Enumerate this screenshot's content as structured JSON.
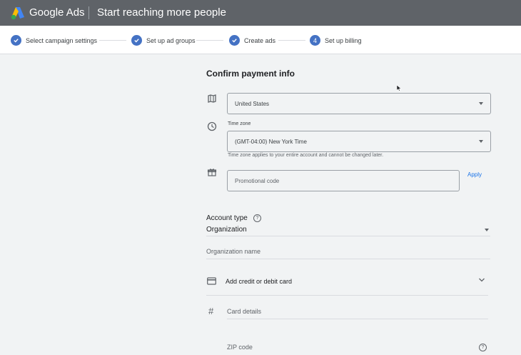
{
  "app": {
    "brand": "Google Ads",
    "heading": "Start reaching more people"
  },
  "stepper": {
    "steps": [
      {
        "label": "Select campaign settings",
        "state": "done"
      },
      {
        "label": "Set up ad groups",
        "state": "done"
      },
      {
        "label": "Create ads",
        "state": "done"
      },
      {
        "label": "Set up billing",
        "state": "current",
        "number": "4"
      }
    ]
  },
  "form": {
    "title": "Confirm payment info",
    "country": {
      "value": "United States",
      "icon": "map-icon"
    },
    "timezone": {
      "label": "Time zone",
      "value": "(GMT-04:00) New York Time",
      "hint": "Time zone applies to your entire account and cannot be changed later.",
      "icon": "clock-icon"
    },
    "promo": {
      "placeholder": "Promotional code",
      "apply_label": "Apply",
      "icon": "gift-icon"
    },
    "account_type": {
      "label": "Account type",
      "value": "Organization",
      "help": "?"
    },
    "organization_name": {
      "placeholder": "Organization name"
    },
    "card": {
      "label": "Add credit or debit card",
      "icon": "credit-card-icon"
    },
    "card_details": {
      "placeholder": "Card details",
      "icon_glyph": "#"
    },
    "zip": {
      "placeholder": "ZIP code",
      "help": "?"
    }
  },
  "colors": {
    "topbar": "#5f6368",
    "accent": "#4472c4",
    "link": "#1a73e8",
    "background": "#f1f3f4"
  }
}
